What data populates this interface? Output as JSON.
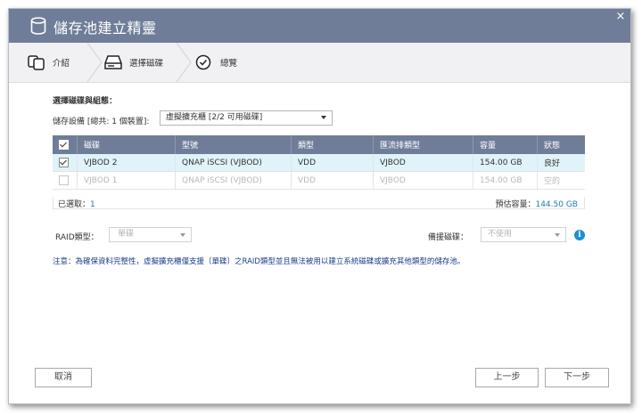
{
  "window": {
    "title": "儲存池建立精靈",
    "close": "×"
  },
  "steps": [
    {
      "label": "介紹",
      "icon": "disks-icon"
    },
    {
      "label": "選擇磁碟",
      "icon": "drive-icon"
    },
    {
      "label": "總覽",
      "icon": "checkmark-circle-icon"
    }
  ],
  "form": {
    "section_title": "選擇磁碟與組態：",
    "device_label": "儲存設備 [總共: 1 個裝置]:",
    "device_value": "虛擬擴充櫃 [2/2 可用磁碟]"
  },
  "table": {
    "columns": [
      "磁碟",
      "型號",
      "類型",
      "匯流排類型",
      "容量",
      "狀態"
    ],
    "rows": [
      {
        "checked": true,
        "disk": "VJBOD 2",
        "model": "QNAP iSCSI (VJBOD)",
        "type": "VDD",
        "bus": "VJBOD",
        "capacity": "154.00 GB",
        "status": "良好"
      },
      {
        "checked": false,
        "disk": "VJBOD 1",
        "model": "QNAP iSCSI (VJBOD)",
        "type": "VDD",
        "bus": "VJBOD",
        "capacity": "154.00 GB",
        "status": "空的"
      }
    ],
    "selected_label": "已選取：",
    "selected_count": "1",
    "estimated_label": "預估容量：",
    "estimated_value": "144.50 GB"
  },
  "raid": {
    "label": "RAID類型：",
    "value": "單碟"
  },
  "spare": {
    "label": "備援磁碟：",
    "value": "不使用"
  },
  "note": "注意：為確保資料完整性，虛擬擴充櫃僅支援〔單碟〕之RAID類型並且無法被用以建立系統磁碟或擴充其他類型的儲存池。",
  "buttons": {
    "cancel": "取消",
    "prev": "上一步",
    "next": "下一步"
  }
}
